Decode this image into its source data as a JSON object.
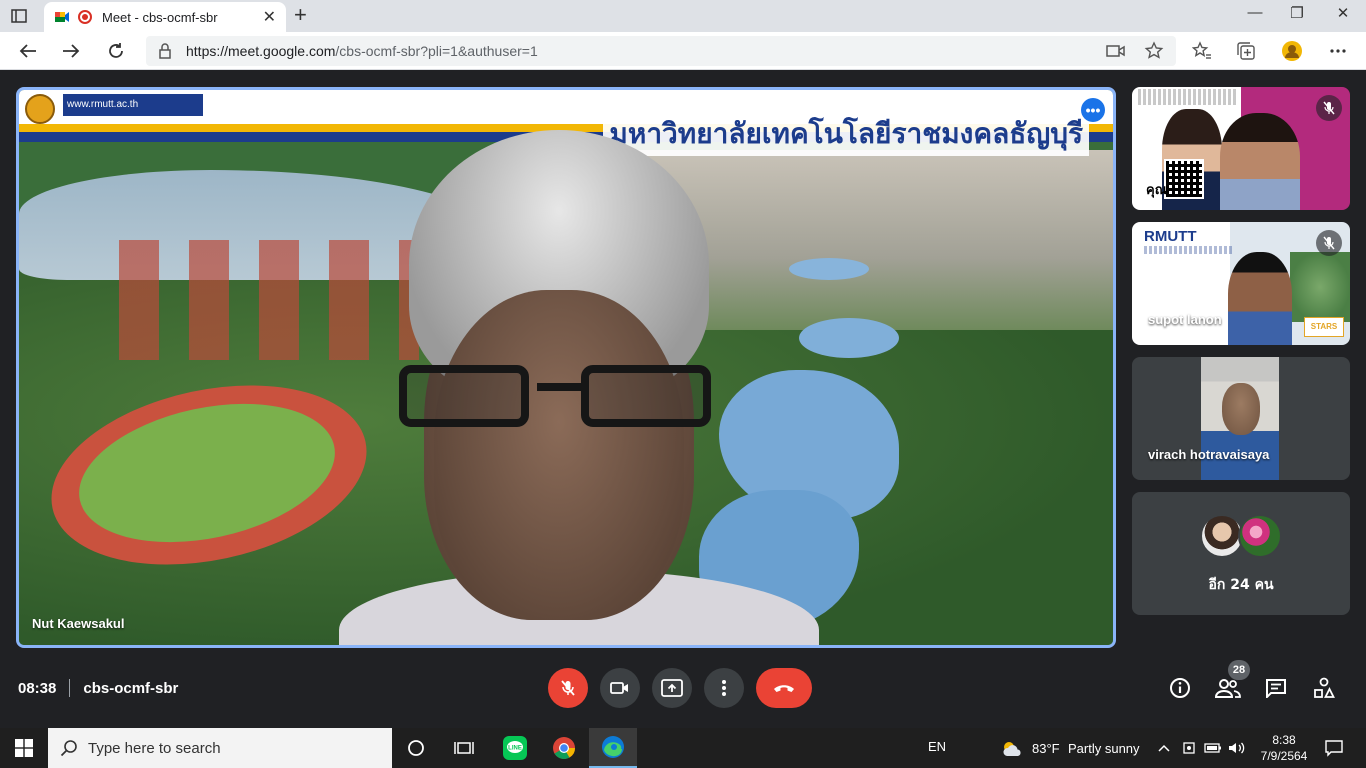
{
  "browser": {
    "tab_title": "Meet - cbs-ocmf-sbr",
    "url_host": "https://meet.google.com",
    "url_path": "/cbs-ocmf-sbr?pli=1&authuser=1"
  },
  "stage": {
    "presenter_name": "Nut Kaewsakul",
    "banner_site": "www.rmutt.ac.th",
    "banner_title": "มหาวิทยาลัยเทคโนโลยีราชมงคลธัญบุรี"
  },
  "participants": [
    {
      "name": "",
      "overlay_text": "คุณ"
    },
    {
      "name": "supot lanon",
      "brand": "RMUTT",
      "badge": "STARS"
    },
    {
      "name": "virach hotravaisaya"
    }
  ],
  "others": {
    "label": "อีก 24 คน"
  },
  "meeting": {
    "time": "08:38",
    "code": "cbs-ocmf-sbr",
    "people_count": "28"
  },
  "taskbar": {
    "search_placeholder": "Type here to search",
    "language": "EN",
    "weather_temp": "83°F",
    "weather_desc": "Partly sunny",
    "clock_time": "8:38",
    "clock_date": "7/9/2564"
  },
  "colors": {
    "meet_bg": "#202124",
    "accent_blue": "#8ab4f8",
    "danger_red": "#ea4335",
    "tile_bg": "#3c4043"
  }
}
